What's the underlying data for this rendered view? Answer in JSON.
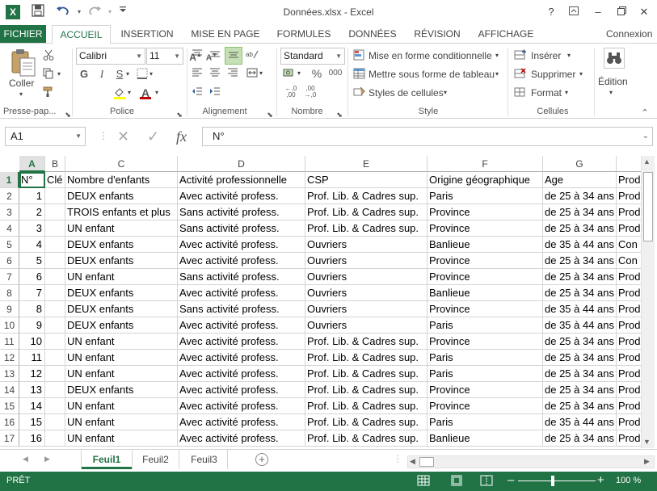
{
  "window": {
    "title": "Données.xlsx - Excel",
    "app_logo": "X",
    "help": "?",
    "ribbon_display": "⧉",
    "minimize": "–",
    "restore": "❐",
    "close": "✕"
  },
  "quick_access": {
    "save_icon": "save-icon",
    "undo_icon": "undo-icon",
    "redo_icon": "redo-icon",
    "customize_icon": "customize-icon"
  },
  "tabs": {
    "file": "FICHIER",
    "home": "ACCUEIL",
    "insert": "INSERTION",
    "layout": "MISE EN PAGE",
    "formulas": "FORMULES",
    "data": "DONNÉES",
    "review": "RÉVISION",
    "view": "AFFICHAGE",
    "signin": "Connexion"
  },
  "ribbon": {
    "clipboard": {
      "paste": "Coller",
      "label": "Presse-pap..."
    },
    "font": {
      "name": "Calibri",
      "size": "11",
      "bold": "G",
      "italic": "I",
      "underline": "S",
      "label": "Police"
    },
    "alignment": {
      "label": "Alignement"
    },
    "number": {
      "format": "Standard",
      "percent": "%",
      "thousands": "000",
      "label": "Nombre"
    },
    "styles": {
      "conditional": "Mise en forme conditionnelle",
      "table": "Mettre sous forme de tableau",
      "cell_styles": "Styles de cellules",
      "label": "Style"
    },
    "cells": {
      "insert": "Insérer",
      "delete": "Supprimer",
      "format": "Format",
      "label": "Cellules"
    },
    "editing": {
      "label": "Édition"
    }
  },
  "formula_bar": {
    "name_box": "A1",
    "fx": "fx",
    "content": "N°"
  },
  "columns": [
    "A",
    "B",
    "C",
    "D",
    "E",
    "F",
    "G"
  ],
  "col_h_partial": "",
  "header_row": {
    "row": "1",
    "cells": [
      "N°",
      "Clé",
      "Nombre d'enfants",
      "Activité professionnelle",
      "CSP",
      "Origine géographique",
      "Age",
      "Prod"
    ]
  },
  "rows": [
    {
      "row": "2",
      "cells": [
        "1",
        "",
        "DEUX enfants",
        "Avec activité profess.",
        "Prof. Lib. & Cadres sup.",
        "Paris",
        "de 25 à 34 ans",
        "Prod"
      ]
    },
    {
      "row": "3",
      "cells": [
        "2",
        "",
        "TROIS enfants et plus",
        "Sans activité profess.",
        "Prof. Lib. & Cadres sup.",
        "Province",
        "de 25 à 34 ans",
        "Prod"
      ]
    },
    {
      "row": "4",
      "cells": [
        "3",
        "",
        "UN enfant",
        "Sans activité profess.",
        "Prof. Lib. & Cadres sup.",
        "Province",
        "de 25 à 34 ans",
        "Prod"
      ]
    },
    {
      "row": "5",
      "cells": [
        "4",
        "",
        "DEUX enfants",
        "Avec activité profess.",
        "Ouvriers",
        "Banlieue",
        "de 35 à 44 ans",
        "Con"
      ]
    },
    {
      "row": "6",
      "cells": [
        "5",
        "",
        "DEUX enfants",
        "Avec activité profess.",
        "Ouvriers",
        "Province",
        "de 25 à 34 ans",
        "Con"
      ]
    },
    {
      "row": "7",
      "cells": [
        "6",
        "",
        "UN enfant",
        "Sans activité profess.",
        "Ouvriers",
        "Province",
        "de 25 à 34 ans",
        "Prod"
      ]
    },
    {
      "row": "8",
      "cells": [
        "7",
        "",
        "DEUX enfants",
        "Avec activité profess.",
        "Ouvriers",
        "Banlieue",
        "de 25 à 34 ans",
        "Prod"
      ]
    },
    {
      "row": "9",
      "cells": [
        "8",
        "",
        "DEUX enfants",
        "Sans activité profess.",
        "Ouvriers",
        "Province",
        "de 35 à 44 ans",
        "Prod"
      ]
    },
    {
      "row": "10",
      "cells": [
        "9",
        "",
        "DEUX enfants",
        "Avec activité profess.",
        "Ouvriers",
        "Paris",
        "de 35 à 44 ans",
        "Prod"
      ]
    },
    {
      "row": "11",
      "cells": [
        "10",
        "",
        "UN enfant",
        "Avec activité profess.",
        "Prof. Lib. & Cadres sup.",
        "Province",
        "de 25 à 34 ans",
        "Prod"
      ]
    },
    {
      "row": "12",
      "cells": [
        "11",
        "",
        "UN enfant",
        "Avec activité profess.",
        "Prof. Lib. & Cadres sup.",
        "Paris",
        "de 25 à 34 ans",
        "Prod"
      ]
    },
    {
      "row": "13",
      "cells": [
        "12",
        "",
        "UN enfant",
        "Avec activité profess.",
        "Prof. Lib. & Cadres sup.",
        "Paris",
        "de 25 à 34 ans",
        "Prod"
      ]
    },
    {
      "row": "14",
      "cells": [
        "13",
        "",
        "DEUX enfants",
        "Avec activité profess.",
        "Prof. Lib. & Cadres sup.",
        "Province",
        "de 25 à 34 ans",
        "Prod"
      ]
    },
    {
      "row": "15",
      "cells": [
        "14",
        "",
        "UN enfant",
        "Avec activité profess.",
        "Prof. Lib. & Cadres sup.",
        "Province",
        "de 25 à 34 ans",
        "Prod"
      ]
    },
    {
      "row": "16",
      "cells": [
        "15",
        "",
        "UN enfant",
        "Avec activité profess.",
        "Prof. Lib. & Cadres sup.",
        "Paris",
        "de 35 à 44 ans",
        "Prod"
      ]
    },
    {
      "row": "17",
      "cells": [
        "16",
        "",
        "UN enfant",
        "Avec activité profess.",
        "Prof. Lib. & Cadres sup.",
        "Banlieue",
        "de 25 à 34 ans",
        "Prod"
      ]
    }
  ],
  "sheets": {
    "s1": "Feuil1",
    "s2": "Feuil2",
    "s3": "Feuil3",
    "add": "+"
  },
  "status": {
    "ready": "PRÊT",
    "zoom": "100 %",
    "zoom_minus": "–",
    "zoom_plus": "+"
  },
  "colors": {
    "accent": "#217346"
  }
}
